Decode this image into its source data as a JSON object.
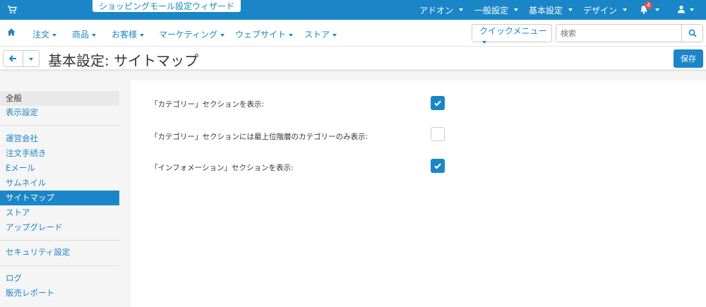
{
  "topbar": {
    "wizard_label": "ショッピングモール設定ウィザード",
    "menus": [
      "アドオン",
      "一般設定",
      "基本設定",
      "デザイン"
    ],
    "notification_count": "4"
  },
  "navbar": {
    "items": [
      "注文",
      "商品",
      "お客様",
      "マーケティング",
      "ウェブサイト",
      "ストア"
    ],
    "quick_menu_label": "クイックメニュー",
    "search_placeholder": "検索"
  },
  "titlebar": {
    "title": "基本設定: サイトマップ",
    "save_label": "保存"
  },
  "sidebar": {
    "general_header": "全般",
    "display_settings": "表示設定",
    "items": [
      "運営会社",
      "注文手続き",
      "Eメール",
      "サムネイル",
      "サイトマップ",
      "ストア",
      "アップグレード"
    ],
    "security": "セキュリティ設定",
    "log": "ログ",
    "sales_report": "販売レポート"
  },
  "settings": [
    {
      "label": "「カテゴリー」セクションを表示:",
      "checked": true
    },
    {
      "label": "「カテゴリー」セクションには最上位階層のカテゴリーのみ表示:",
      "checked": false
    },
    {
      "label": "「インフォメーション」セクションを表示:",
      "checked": true
    }
  ],
  "colors": {
    "accent": "#1a86c8",
    "badge": "#d9534f"
  }
}
